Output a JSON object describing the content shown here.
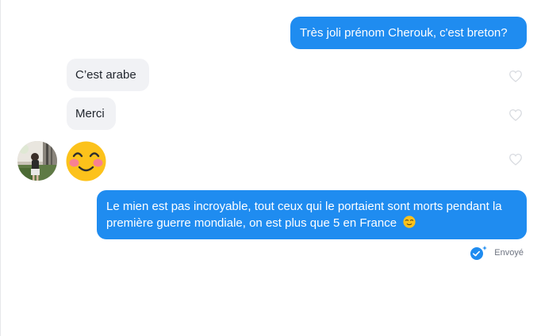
{
  "messages": [
    {
      "text": "Très joli prénom Cherouk, c'est breton?"
    },
    {
      "text": "C’est arabe"
    },
    {
      "text": "Merci"
    },
    {
      "text": "Le mien est pas incroyable, tout ceux qui le portaient sont morts pendant la première guerre mondiale, on est plus que 5 en France"
    }
  ],
  "status": {
    "label": "Envoyé",
    "icon": "double-check-sparkle-icon"
  },
  "icons": {
    "like": "heart-outline-icon",
    "reaction_emoji": "smiling-blush-emoji",
    "inline_emoji": "relieved-face-emoji"
  },
  "colors": {
    "sent_bubble": "#1f8cf0",
    "received_bubble": "#f1f2f5",
    "status_icon": "#1f8cf0"
  }
}
